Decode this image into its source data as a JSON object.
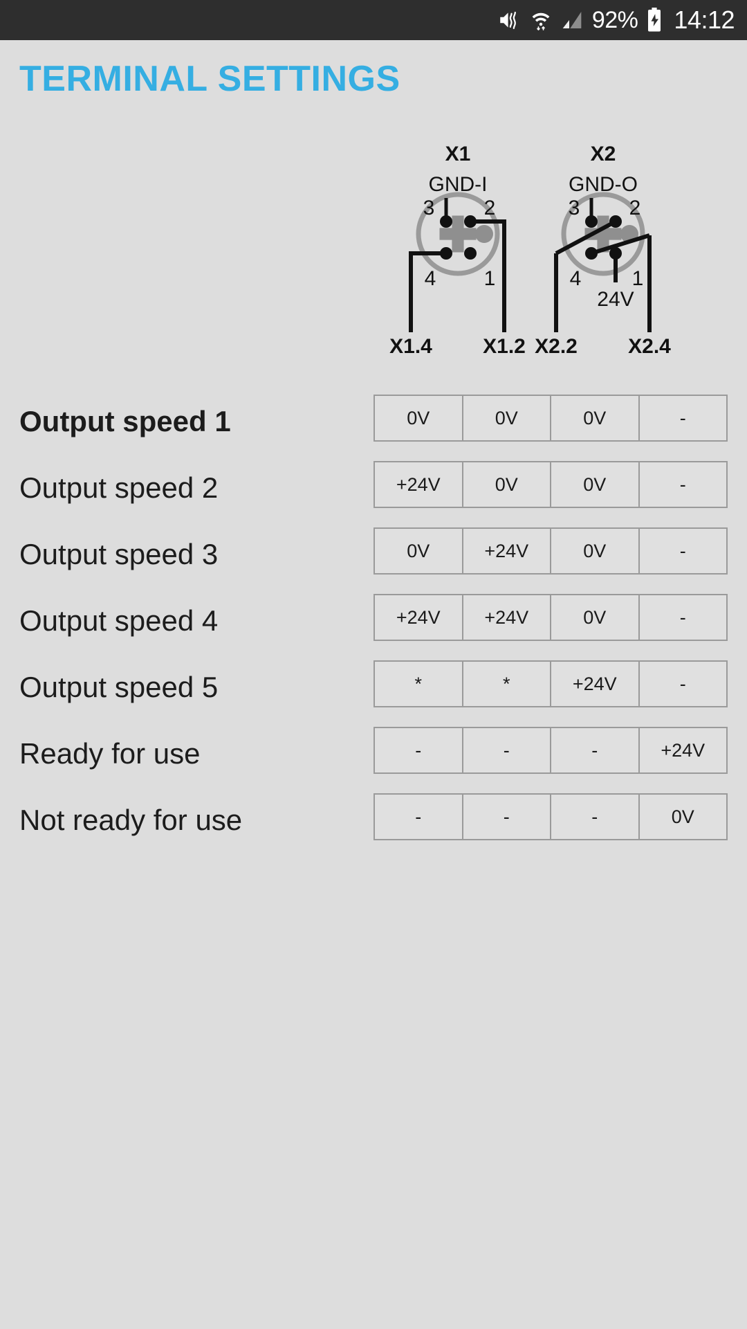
{
  "statusbar": {
    "icons": [
      "mute-icon",
      "wifi-icon",
      "signal-icon",
      "battery-charging-icon"
    ],
    "battery_percent": "92%",
    "clock": "14:12"
  },
  "header": {
    "title": "TERMINAL SETTINGS",
    "accent_color": "#35aee2"
  },
  "diagram": {
    "connectors": [
      {
        "name": "X1",
        "gnd_label": "GND-I",
        "pins": [
          "3",
          "2",
          "4",
          "1"
        ],
        "extra_label": ""
      },
      {
        "name": "X2",
        "gnd_label": "GND-O",
        "pins": [
          "3",
          "2",
          "4",
          "1"
        ],
        "extra_label": "24V"
      }
    ],
    "terminal_labels": [
      "X1.4",
      "X1.2",
      "X2.2",
      "X2.4"
    ]
  },
  "table": {
    "columns": [
      "X1.4",
      "X1.2",
      "X2.2",
      "X2.4"
    ],
    "rows": [
      {
        "label": "Output speed 1",
        "selected": true,
        "values": [
          "0V",
          "0V",
          "0V",
          "-"
        ]
      },
      {
        "label": "Output speed 2",
        "selected": false,
        "values": [
          "+24V",
          "0V",
          "0V",
          "-"
        ]
      },
      {
        "label": "Output speed 3",
        "selected": false,
        "values": [
          "0V",
          "+24V",
          "0V",
          "-"
        ]
      },
      {
        "label": "Output speed 4",
        "selected": false,
        "values": [
          "+24V",
          "+24V",
          "0V",
          "-"
        ]
      },
      {
        "label": "Output speed 5",
        "selected": false,
        "values": [
          "*",
          "*",
          "+24V",
          "-"
        ]
      },
      {
        "label": "Ready for use",
        "selected": false,
        "values": [
          "-",
          "-",
          "-",
          "+24V"
        ]
      },
      {
        "label": "Not ready for use",
        "selected": false,
        "values": [
          "-",
          "-",
          "-",
          "0V"
        ]
      }
    ]
  }
}
